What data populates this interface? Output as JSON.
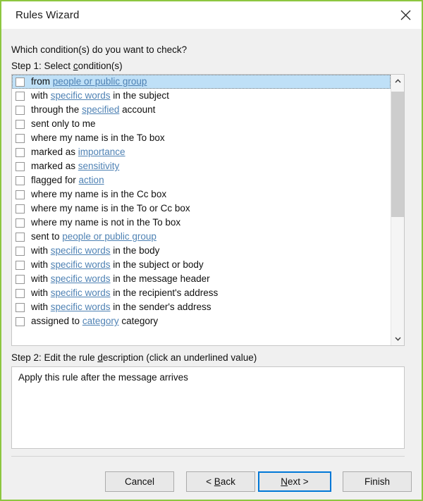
{
  "window": {
    "title": "Rules Wizard",
    "close_icon": "close-icon",
    "border_color": "#8dc63f"
  },
  "colors": {
    "accent": "#0078d7",
    "link": "#4f82b4",
    "selection": "#bfe0f7",
    "dialog_background": "#f0f0f0",
    "border": "#8dc63f"
  },
  "main": {
    "prompt": "Which condition(s) do you want to check?",
    "step1": {
      "label_before": "Step 1: Select ",
      "label_accel": "c",
      "label_after": "ondition(s)"
    },
    "conditions": [
      {
        "checked": false,
        "selected": true,
        "parts": [
          {
            "t": "from ",
            "link": false
          },
          {
            "t": "people or public group",
            "link": true
          }
        ]
      },
      {
        "checked": false,
        "selected": false,
        "parts": [
          {
            "t": "with ",
            "link": false
          },
          {
            "t": "specific words",
            "link": true
          },
          {
            "t": " in the subject",
            "link": false
          }
        ]
      },
      {
        "checked": false,
        "selected": false,
        "parts": [
          {
            "t": "through the ",
            "link": false
          },
          {
            "t": "specified",
            "link": true
          },
          {
            "t": " account",
            "link": false
          }
        ]
      },
      {
        "checked": false,
        "selected": false,
        "parts": [
          {
            "t": "sent only to me",
            "link": false
          }
        ]
      },
      {
        "checked": false,
        "selected": false,
        "parts": [
          {
            "t": "where my name is in the To box",
            "link": false
          }
        ]
      },
      {
        "checked": false,
        "selected": false,
        "parts": [
          {
            "t": "marked as ",
            "link": false
          },
          {
            "t": "importance",
            "link": true
          }
        ]
      },
      {
        "checked": false,
        "selected": false,
        "parts": [
          {
            "t": "marked as ",
            "link": false
          },
          {
            "t": "sensitivity",
            "link": true
          }
        ]
      },
      {
        "checked": false,
        "selected": false,
        "parts": [
          {
            "t": "flagged for ",
            "link": false
          },
          {
            "t": "action",
            "link": true
          }
        ]
      },
      {
        "checked": false,
        "selected": false,
        "parts": [
          {
            "t": "where my name is in the Cc box",
            "link": false
          }
        ]
      },
      {
        "checked": false,
        "selected": false,
        "parts": [
          {
            "t": "where my name is in the To or Cc box",
            "link": false
          }
        ]
      },
      {
        "checked": false,
        "selected": false,
        "parts": [
          {
            "t": "where my name is not in the To box",
            "link": false
          }
        ]
      },
      {
        "checked": false,
        "selected": false,
        "parts": [
          {
            "t": "sent to ",
            "link": false
          },
          {
            "t": "people or public group",
            "link": true
          }
        ]
      },
      {
        "checked": false,
        "selected": false,
        "parts": [
          {
            "t": "with ",
            "link": false
          },
          {
            "t": "specific words",
            "link": true
          },
          {
            "t": " in the body",
            "link": false
          }
        ]
      },
      {
        "checked": false,
        "selected": false,
        "parts": [
          {
            "t": "with ",
            "link": false
          },
          {
            "t": "specific words",
            "link": true
          },
          {
            "t": " in the subject or body",
            "link": false
          }
        ]
      },
      {
        "checked": false,
        "selected": false,
        "parts": [
          {
            "t": "with ",
            "link": false
          },
          {
            "t": "specific words",
            "link": true
          },
          {
            "t": " in the message header",
            "link": false
          }
        ]
      },
      {
        "checked": false,
        "selected": false,
        "parts": [
          {
            "t": "with ",
            "link": false
          },
          {
            "t": "specific words",
            "link": true
          },
          {
            "t": " in the recipient's address",
            "link": false
          }
        ]
      },
      {
        "checked": false,
        "selected": false,
        "parts": [
          {
            "t": "with ",
            "link": false
          },
          {
            "t": "specific words",
            "link": true
          },
          {
            "t": " in the sender's address",
            "link": false
          }
        ]
      },
      {
        "checked": false,
        "selected": false,
        "parts": [
          {
            "t": "assigned to ",
            "link": false
          },
          {
            "t": "category",
            "link": true
          },
          {
            "t": " category",
            "link": false
          }
        ]
      }
    ],
    "scrollbar": {
      "up_icon": "chevron-up-icon",
      "down_icon": "chevron-down-icon"
    },
    "step2": {
      "label_before": "Step 2: Edit the rule ",
      "label_accel": "d",
      "label_after": "escription (click an underlined value)",
      "description": "Apply this rule after the message arrives"
    }
  },
  "footer": {
    "cancel": {
      "label": "Cancel"
    },
    "back": {
      "prefix": "< ",
      "accel": "B",
      "suffix": "ack"
    },
    "next": {
      "prefix": "",
      "accel": "N",
      "suffix": "ext >",
      "default": true
    },
    "finish": {
      "label": "Finish"
    }
  }
}
